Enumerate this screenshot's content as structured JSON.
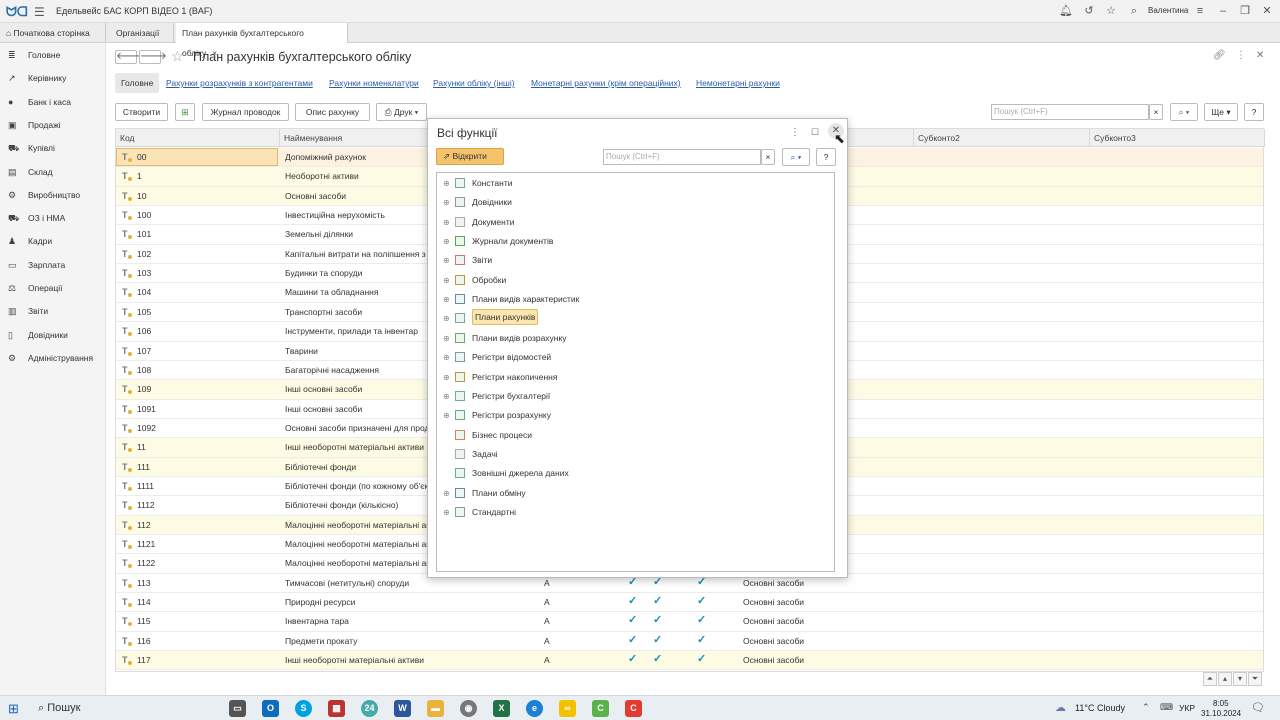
{
  "app": {
    "title": "Едельвейс БАС КОРП ВІДЕО 1  (BAF)",
    "user": "Валентина"
  },
  "tabs": [
    {
      "label": "Початкова сторінка"
    },
    {
      "label": "Організації"
    },
    {
      "label": "План рахунків бухгалтерського обліку",
      "close": "×"
    }
  ],
  "sidebar": {
    "items": [
      {
        "label": "Головне",
        "icon": "list-icon"
      },
      {
        "label": "Керівнику",
        "icon": "chart-line-icon"
      },
      {
        "label": "Банк і каса",
        "icon": "coin-icon"
      },
      {
        "label": "Продажі",
        "icon": "bag-icon"
      },
      {
        "label": "Купівлі",
        "icon": "cart-icon"
      },
      {
        "label": "Склад",
        "icon": "warehouse-icon"
      },
      {
        "label": "Виробництво",
        "icon": "factory-icon"
      },
      {
        "label": "ОЗ і НМА",
        "icon": "truck-icon"
      },
      {
        "label": "Кадри",
        "icon": "person-icon"
      },
      {
        "label": "Зарплата",
        "icon": "wallet-icon"
      },
      {
        "label": "Операції",
        "icon": "balance-icon"
      },
      {
        "label": "Звіти",
        "icon": "bar-chart-icon"
      },
      {
        "label": "Довідники",
        "icon": "book-icon"
      },
      {
        "label": "Адміністрування",
        "icon": "gear-icon"
      }
    ]
  },
  "page": {
    "title": "План рахунків бухгалтерського обліку",
    "subtabs": [
      "Головне",
      "Рахунки розрахунків з контрагентами",
      "Рахунки номенклатури",
      "Рахунки обліку (інші)",
      "Монетарні рахунки (крім операційних)",
      "Немонетарні рахунки"
    ],
    "toolbar": {
      "create": "Створити",
      "journal": "Журнал проводок",
      "desc": "Опис рахунку",
      "print": "Друк",
      "more": "Ще",
      "help": "?"
    },
    "search_placeholder": "Пошук (Ctrl+F)",
    "search_clear": "×"
  },
  "table": {
    "headers": {
      "code": "Код",
      "name": "Найменування",
      "sub2": "Субконто2",
      "sub3": "Субконто3"
    },
    "rows": [
      {
        "code": "00",
        "name": "Допоміжний рахунок",
        "vid": "",
        "checks": false,
        "sub1": ""
      },
      {
        "code": "1",
        "name": "Необоротні активи",
        "vid": "",
        "checks": false,
        "sub1": ""
      },
      {
        "code": "10",
        "name": "Основні засоби",
        "vid": "",
        "checks": false,
        "sub1": ""
      },
      {
        "code": "100",
        "name": "Інвестиційна нерухомість",
        "vid": "",
        "checks": false,
        "sub1": ""
      },
      {
        "code": "101",
        "name": "Земельні ділянки",
        "vid": "",
        "checks": false,
        "sub1": ""
      },
      {
        "code": "102",
        "name": "Капітальні витрати на поліпшення  з",
        "vid": "",
        "checks": false,
        "sub1": ""
      },
      {
        "code": "103",
        "name": "Будинки та споруди",
        "vid": "",
        "checks": false,
        "sub1": ""
      },
      {
        "code": "104",
        "name": "Машини та обладнання",
        "vid": "",
        "checks": false,
        "sub1": ""
      },
      {
        "code": "105",
        "name": "Транспортні засоби",
        "vid": "",
        "checks": false,
        "sub1": ""
      },
      {
        "code": "106",
        "name": "Інструменти, прилади та інвентар",
        "vid": "",
        "checks": false,
        "sub1": ""
      },
      {
        "code": "107",
        "name": "Тварини",
        "vid": "",
        "checks": false,
        "sub1": ""
      },
      {
        "code": "108",
        "name": "Багаторічні насадження",
        "vid": "",
        "checks": false,
        "sub1": ""
      },
      {
        "code": "109",
        "name": "Інші основні засоби",
        "vid": "",
        "checks": false,
        "sub1": ""
      },
      {
        "code": "1091",
        "name": "Інші основні засоби",
        "vid": "",
        "checks": false,
        "sub1": ""
      },
      {
        "code": "1092",
        "name": "Основні засоби призначені для прод",
        "vid": "",
        "checks": false,
        "sub1": ""
      },
      {
        "code": "11",
        "name": "Інші необоротні матеріальні активи",
        "vid": "",
        "checks": false,
        "sub1": ""
      },
      {
        "code": "111",
        "name": "Бібліотечні фонди",
        "vid": "",
        "checks": false,
        "sub1": ""
      },
      {
        "code": "1111",
        "name": "Бібліотечні фонди (по кожному об'єк",
        "vid": "",
        "checks": false,
        "sub1": ""
      },
      {
        "code": "1112",
        "name": "Бібліотечні фонди (кількісно)",
        "vid": "",
        "checks": false,
        "sub1": ""
      },
      {
        "code": "112",
        "name": "Малоцінні необоротні матеріальні ак",
        "vid": "",
        "checks": false,
        "sub1": ""
      },
      {
        "code": "1121",
        "name": "Малоцінні необоротні матеріальні ак",
        "vid": "",
        "checks": false,
        "sub1": ""
      },
      {
        "code": "1122",
        "name": "Малоцінні необоротні матеріальні ак",
        "vid": "",
        "checks": false,
        "sub1": ""
      },
      {
        "code": "113",
        "name": "Тимчасові (нетитульні) споруди",
        "vid": "А",
        "checks": true,
        "sub1": "Основні засоби"
      },
      {
        "code": "114",
        "name": "Природні ресурси",
        "vid": "А",
        "checks": true,
        "sub1": "Основні засоби"
      },
      {
        "code": "115",
        "name": "Інвентарна тара",
        "vid": "А",
        "checks": true,
        "sub1": "Основні засоби"
      },
      {
        "code": "116",
        "name": "Предмети прокату",
        "vid": "А",
        "checks": true,
        "sub1": "Основні засоби"
      },
      {
        "code": "117",
        "name": "Інші необоротні матеріальні активи",
        "vid": "А",
        "checks": true,
        "sub1": "Основні засоби"
      }
    ]
  },
  "modal": {
    "title": "Всі функції",
    "open_button": "Відкрити",
    "search_placeholder": "Пошук (Ctrl+F)",
    "search_clear": "×",
    "help": "?",
    "tree": [
      {
        "label": "Константи",
        "expand": true
      },
      {
        "label": "Довідники",
        "expand": true
      },
      {
        "label": "Документи",
        "expand": true
      },
      {
        "label": "Журнали документів",
        "expand": true
      },
      {
        "label": "Звіти",
        "expand": true
      },
      {
        "label": "Обробки",
        "expand": true
      },
      {
        "label": "Плани видів характеристик",
        "expand": true
      },
      {
        "label": "Плани рахунків",
        "expand": true,
        "selected": true
      },
      {
        "label": "Плани видів розрахунку",
        "expand": true
      },
      {
        "label": "Регістри відомостей",
        "expand": true
      },
      {
        "label": "Регістри накопичення",
        "expand": true
      },
      {
        "label": "Регістри бухгалтерії",
        "expand": true
      },
      {
        "label": "Регістри розрахунку",
        "expand": true
      },
      {
        "label": "Бізнес процеси",
        "expand": false
      },
      {
        "label": "Задачі",
        "expand": false
      },
      {
        "label": "Зовнішні джерела даних",
        "expand": false
      },
      {
        "label": "Плани обміну",
        "expand": true
      },
      {
        "label": "Стандартні",
        "expand": true
      }
    ]
  },
  "taskbar": {
    "search": "Пошук",
    "weather": "11°C  Cloudy",
    "lang": "УКР",
    "time": "8:05",
    "date": "31.10.2024"
  },
  "colors": {
    "accent": "#f5c36b",
    "link": "#2a5ca8",
    "row_highlight": "#fdfbe4",
    "check": "#1a8fb5"
  }
}
